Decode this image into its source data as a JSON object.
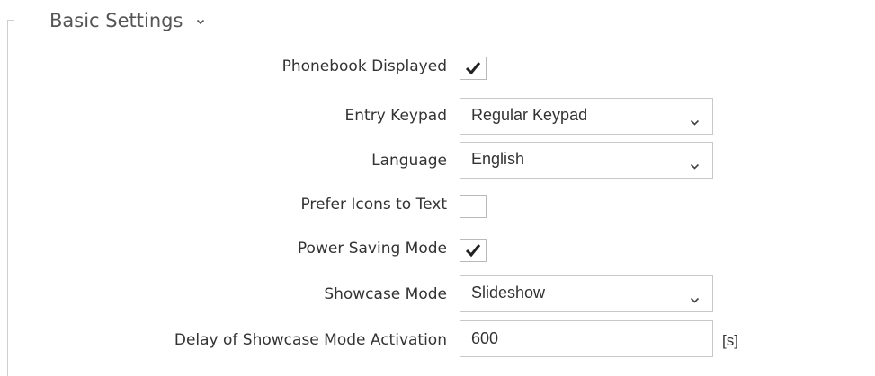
{
  "section": {
    "title": "Basic Settings",
    "chevron_icon": "chevron-down-icon"
  },
  "settings": {
    "phonebook_displayed": {
      "label": "Phonebook Displayed",
      "checked": true
    },
    "entry_keypad": {
      "label": "Entry Keypad",
      "value": "Regular Keypad"
    },
    "language": {
      "label": "Language",
      "value": "English"
    },
    "prefer_icons": {
      "label": "Prefer Icons to Text",
      "checked": false
    },
    "power_saving": {
      "label": "Power Saving Mode",
      "checked": true
    },
    "showcase_mode": {
      "label": "Showcase Mode",
      "value": "Slideshow"
    },
    "showcase_delay": {
      "label": "Delay of Showcase Mode Activation",
      "value": "600",
      "unit": "[s]"
    }
  }
}
